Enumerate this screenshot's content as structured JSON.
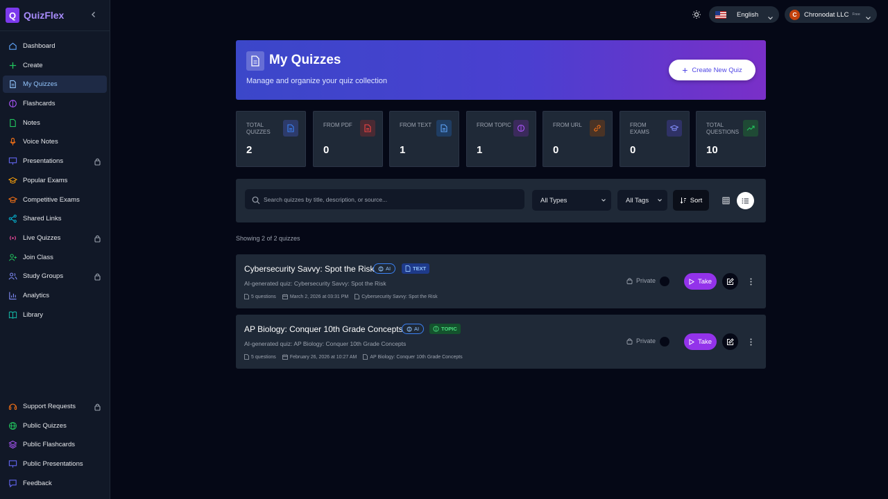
{
  "app": {
    "logo_letter": "Q",
    "name": "QuizFlex"
  },
  "sidebar": {
    "items": [
      {
        "label": "Dashboard",
        "icon": "home-icon"
      },
      {
        "label": "Create",
        "icon": "plus-icon"
      },
      {
        "label": "My Quizzes",
        "icon": "document-icon",
        "active": true
      },
      {
        "label": "Flashcards",
        "icon": "brain-icon"
      },
      {
        "label": "Notes",
        "icon": "note-icon"
      },
      {
        "label": "Voice Notes",
        "icon": "microphone-icon"
      },
      {
        "label": "Presentations",
        "icon": "presentation-icon",
        "locked": true
      },
      {
        "label": "Popular Exams",
        "icon": "graduation-cap-icon"
      },
      {
        "label": "Competitive Exams",
        "icon": "graduation-cap-icon"
      },
      {
        "label": "Shared Links",
        "icon": "share-icon"
      },
      {
        "label": "Live Quizzes",
        "icon": "broadcast-icon",
        "locked": true
      },
      {
        "label": "Join Class",
        "icon": "user-plus-icon"
      },
      {
        "label": "Study Groups",
        "icon": "users-icon",
        "locked": true
      },
      {
        "label": "Analytics",
        "icon": "bar-chart-icon"
      },
      {
        "label": "Library",
        "icon": "book-icon"
      }
    ],
    "bottom_items": [
      {
        "label": "Support Requests",
        "icon": "headset-icon",
        "locked": true
      },
      {
        "label": "Public Quizzes",
        "icon": "globe-icon"
      },
      {
        "label": "Public Flashcards",
        "icon": "layers-icon"
      },
      {
        "label": "Public Presentations",
        "icon": "presentation-icon"
      },
      {
        "label": "Feedback",
        "icon": "message-icon"
      }
    ]
  },
  "topbar": {
    "language": "English",
    "user": {
      "initial": "C",
      "name": "Chronodat LLC",
      "plan": "Free"
    }
  },
  "header": {
    "title": "My Quizzes",
    "subtitle": "Manage and organize your quiz collection",
    "create_button": "Create New Quiz"
  },
  "stats": [
    {
      "label": "Total Quizzes",
      "value": "2",
      "color": "#3b82f6"
    },
    {
      "label": "From PDF",
      "value": "0",
      "color": "#ef4444"
    },
    {
      "label": "From Text",
      "value": "1",
      "color": "#3b82f6"
    },
    {
      "label": "From Topic",
      "value": "1",
      "color": "#a855f7"
    },
    {
      "label": "From URL",
      "value": "0",
      "color": "#f97316"
    },
    {
      "label": "From Exams",
      "value": "0",
      "color": "#6366f1"
    },
    {
      "label": "Total Questions",
      "value": "10",
      "color": "#22c55e"
    }
  ],
  "filters": {
    "search_placeholder": "Search quizzes by title, description, or source...",
    "type_select": "All Types",
    "tag_select": "All Tags",
    "sort_label": "Sort"
  },
  "list": {
    "showing": "Showing 2 of 2 quizzes",
    "quizzes": [
      {
        "title": "Cybersecurity Savvy: Spot the Risk",
        "ai_badge": "AI",
        "type_badge": "TEXT",
        "description": "AI-generated quiz: Cybersecurity Savvy: Spot the Risk",
        "questions": "5 questions",
        "date": "March 2, 2026 at 03:31 PM",
        "source": "Cybersecurity Savvy: Spot the Risk",
        "privacy": "Private",
        "take_label": "Take"
      },
      {
        "title": "AP Biology: Conquer 10th Grade Concepts",
        "ai_badge": "AI",
        "type_badge": "TOPIC",
        "description": "AI-generated quiz: AP Biology: Conquer 10th Grade Concepts",
        "questions": "5 questions",
        "date": "February 26, 2026 at 10:27 AM",
        "source": "AP Biology: Conquer 10th Grade Concepts",
        "privacy": "Private",
        "take_label": "Take"
      }
    ]
  }
}
